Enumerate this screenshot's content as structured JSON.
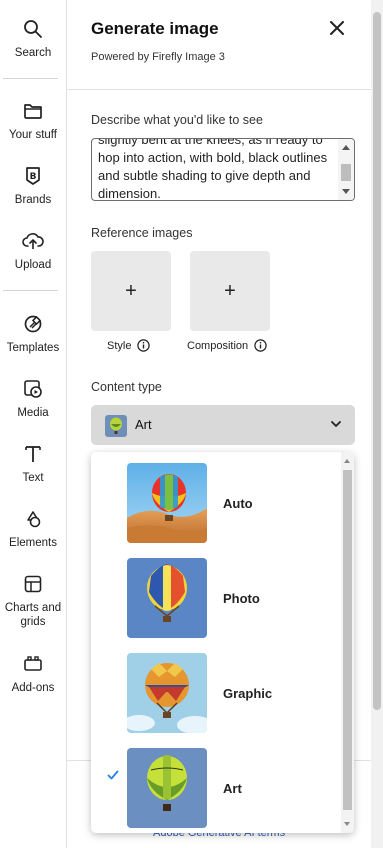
{
  "rail": {
    "items": [
      {
        "label": "Search",
        "icon": "search-icon"
      },
      {
        "label": "Your stuff",
        "icon": "folder-icon"
      },
      {
        "label": "Brands",
        "icon": "brand-icon"
      },
      {
        "label": "Upload",
        "icon": "upload-cloud-icon"
      },
      {
        "label": "Templates",
        "icon": "templates-icon"
      },
      {
        "label": "Media",
        "icon": "media-icon"
      },
      {
        "label": "Text",
        "icon": "text-icon"
      },
      {
        "label": "Elements",
        "icon": "elements-icon"
      },
      {
        "label": "Charts and grids",
        "icon": "charts-grids-icon"
      },
      {
        "label": "Add-ons",
        "icon": "add-ons-icon"
      }
    ]
  },
  "panel": {
    "title": "Generate image",
    "subtitle": "Powered by Firefly Image 3",
    "close_icon": "close-icon",
    "prompt": {
      "label": "Describe what you'd like to see",
      "value": "slightly bent at the knees, as if ready to hop into action, with bold, black outlines and subtle shading to give depth and dimension."
    },
    "reference": {
      "label": "Reference images",
      "tiles": [
        {
          "caption": "Style",
          "plus": "+"
        },
        {
          "caption": "Composition",
          "plus": "+"
        }
      ]
    },
    "content_type": {
      "label": "Content type",
      "selected": "Art",
      "options": [
        {
          "label": "Auto",
          "selected": false
        },
        {
          "label": "Photo",
          "selected": false
        },
        {
          "label": "Graphic",
          "selected": false
        },
        {
          "label": "Art",
          "selected": true
        }
      ]
    },
    "terms_link": "Adobe Generative AI terms"
  },
  "colors": {
    "accent_check": "#2680eb",
    "link": "#2b5fb3",
    "select_bg": "#d9d9d9",
    "tile_bg": "#e9e9e9"
  }
}
